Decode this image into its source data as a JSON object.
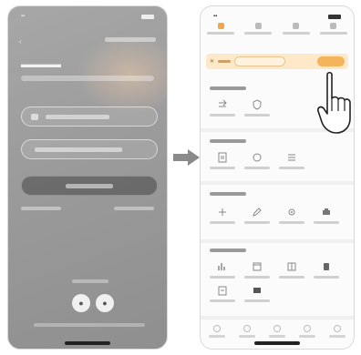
{
  "colors": {
    "accent": "#f3b45c",
    "banner_bg": "#fde8c7",
    "left_overlay": "#9c9c9c",
    "arrow": "#8a8a8a"
  },
  "left_screen": {
    "back_icon": "chevron-left-icon",
    "social_icons": [
      "google-icon",
      "apple-icon"
    ]
  },
  "right_screen": {
    "tab_icons": [
      "home-icon",
      "grid-icon",
      "calendar-icon",
      "chart-icon",
      "user-icon"
    ],
    "banner_icon": "close-icon",
    "section_1_tools": [
      "swap-icon",
      "shield-icon"
    ],
    "section_2_tools": [
      "document-icon",
      "circle-icon",
      "list-icon"
    ],
    "section_3_tools": [
      "plus-icon",
      "pencil-icon",
      "gear-icon",
      "printer-icon"
    ],
    "section_4_tools": [
      "chart-icon",
      "calendar-icon",
      "book-icon",
      "phone-icon",
      "clipboard-icon",
      "folder-icon"
    ],
    "bottom_nav_icons": [
      "home-icon",
      "search-icon",
      "star-icon",
      "bell-icon",
      "menu-icon"
    ]
  }
}
